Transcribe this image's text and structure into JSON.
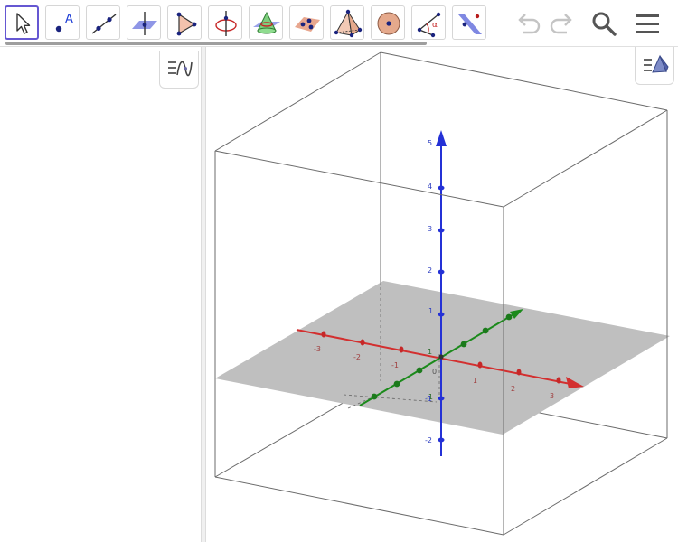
{
  "toolbar": {
    "tools": [
      {
        "name": "move-tool",
        "icon": "arrow-cursor-icon",
        "selected": true
      },
      {
        "name": "point-tool",
        "icon": "point-icon",
        "label": "A"
      },
      {
        "name": "line-tool",
        "icon": "line-icon"
      },
      {
        "name": "perpendicular-line-tool",
        "icon": "perpendicular-line-icon"
      },
      {
        "name": "polygon-tool",
        "icon": "polygon-icon"
      },
      {
        "name": "circle-axis-point-tool",
        "icon": "circle-axis-icon"
      },
      {
        "name": "intersect-surfaces-tool",
        "icon": "cone-icon"
      },
      {
        "name": "plane-three-points-tool",
        "icon": "plane-points-icon"
      },
      {
        "name": "pyramid-tool",
        "icon": "pyramid-icon"
      },
      {
        "name": "sphere-tool",
        "icon": "sphere-icon"
      },
      {
        "name": "angle-tool",
        "icon": "angle-icon",
        "label": "α"
      },
      {
        "name": "reflect-tool",
        "icon": "reflect-plane-icon"
      }
    ],
    "undo_icon": "undo-icon",
    "redo_icon": "redo-icon",
    "search_icon": "search-icon",
    "menu_icon": "hamburger-menu-icon"
  },
  "algebra_view": {
    "toggle_icon": "algebra-style-icon"
  },
  "graphics_3d": {
    "toggle_icon": "graphics3d-style-icon",
    "colors": {
      "x_axis": "#d32f2f",
      "y_axis": "#1b8a1b",
      "z_axis": "#2431d6",
      "plane": "#bdbdbd",
      "box": "#6b6b6b"
    },
    "x_ticks": [
      "-3",
      "-2",
      "-1",
      "1",
      "2",
      "3"
    ],
    "y_ticks": [
      "-1",
      "1"
    ],
    "z_ticks": [
      "-2",
      "-1",
      "1",
      "2",
      "3",
      "4",
      "5"
    ],
    "origin_label": "0"
  }
}
